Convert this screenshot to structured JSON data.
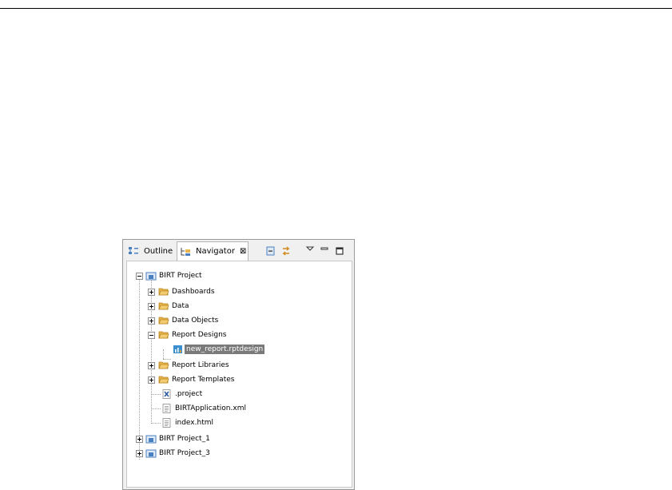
{
  "tabs": {
    "outline": {
      "label": "Outline",
      "icon": "outline-icon"
    },
    "navigator": {
      "label": "Navigator",
      "icon": "navigator-icon",
      "close": "⊠"
    }
  },
  "toolbar": {
    "buttons": [
      "collapse-all-icon",
      "link-with-editor-icon",
      "view-menu-icon",
      "minimize-icon",
      "maximize-icon"
    ]
  },
  "tree": {
    "birt_project": "BIRT Project",
    "dashboards": "Dashboards",
    "data": "Data",
    "data_objects": "Data Objects",
    "report_designs": "Report Designs",
    "new_report": "new_report.rptdesign",
    "report_libraries": "Report Libraries",
    "report_templates": "Report Templates",
    "project_file": ".project",
    "birt_application": "BIRTApplication.xml",
    "index_html": "index.html",
    "birt_project_1": "BIRT Project_1",
    "birt_project_3": "BIRT Project_3"
  },
  "colors": {
    "folder": "#e8b54a",
    "project": "#4a7fc0",
    "selection": "#7a7a7a"
  }
}
